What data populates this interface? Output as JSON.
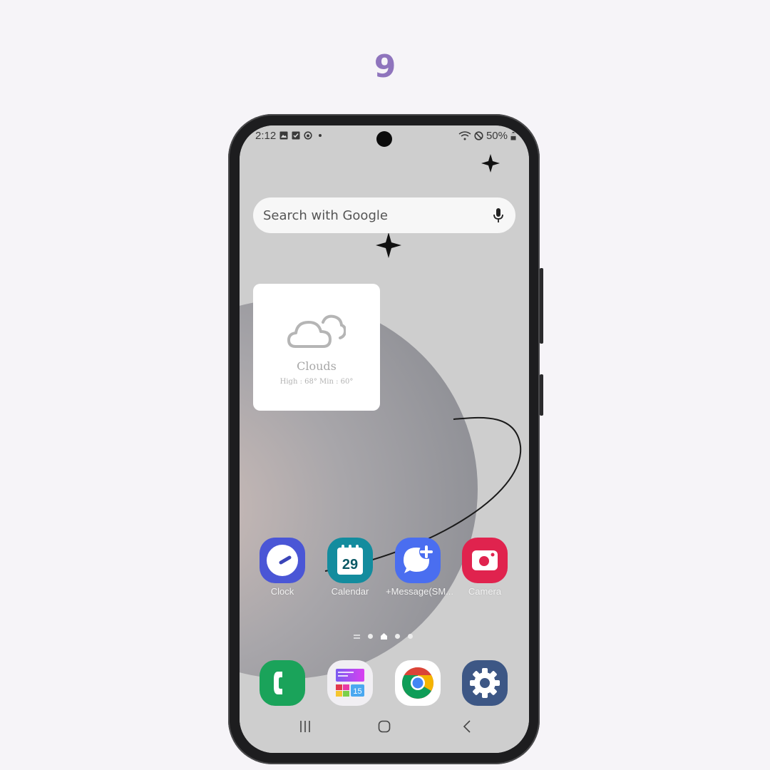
{
  "step": {
    "number": "9"
  },
  "status_bar": {
    "time": "2:12",
    "battery": "50%",
    "left_icons": [
      "gallery-icon",
      "checkbox-icon",
      "sync-icon",
      "dot-icon"
    ],
    "right_icons": [
      "wifi-icon",
      "do-not-disturb-icon",
      "battery-icon"
    ]
  },
  "search": {
    "placeholder": "Search with Google",
    "mic_icon": "mic-icon"
  },
  "weather_widget": {
    "condition": "Clouds",
    "temps": "High : 68° Min : 60°",
    "icon": "clouds-icon"
  },
  "apps": [
    {
      "label": "Clock",
      "icon": "clock-icon",
      "color": "#4a56d6"
    },
    {
      "label": "Calendar",
      "icon": "calendar-icon",
      "color": "#138c9e",
      "date": "29"
    },
    {
      "label": "+Message(SM...",
      "icon": "message-plus-icon",
      "color": "#4a6ef0"
    },
    {
      "label": "Camera",
      "icon": "camera-icon",
      "color": "#e0234e"
    }
  ],
  "page_indicator": {
    "pages": 5,
    "current": 2
  },
  "dock": [
    {
      "name": "Phone",
      "icon": "phone-icon",
      "color": "#1aa35a"
    },
    {
      "name": "Theme Store",
      "icon": "widgets-icon",
      "color": "#f0f0f0",
      "badge": "15"
    },
    {
      "name": "Chrome",
      "icon": "chrome-icon",
      "color": "#ffffff"
    },
    {
      "name": "Settings",
      "icon": "gear-icon",
      "color": "#3d5785"
    }
  ],
  "nav": {
    "recent": "recent-apps-icon",
    "home": "home-icon",
    "back": "back-icon"
  }
}
